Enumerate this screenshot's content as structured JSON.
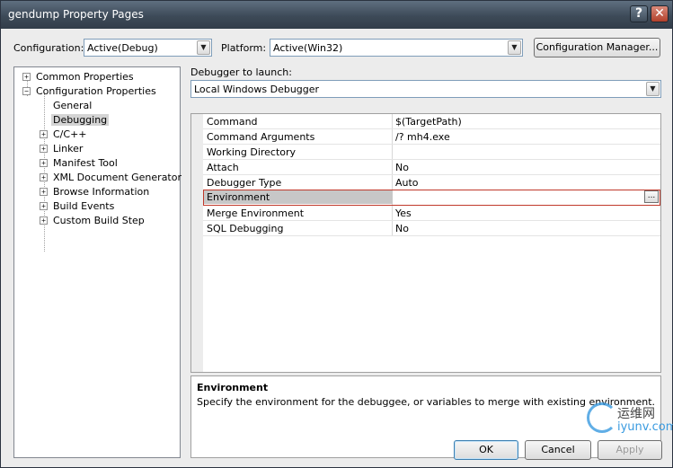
{
  "window": {
    "title": "gendump Property Pages",
    "help_label": "?",
    "close_label": "✕"
  },
  "toolbar": {
    "configuration_label": "Configuration:",
    "configuration_value": "Active(Debug)",
    "platform_label": "Platform:",
    "platform_value": "Active(Win32)",
    "config_manager_label": "Configuration Manager..."
  },
  "tree": {
    "items": [
      {
        "label": "Common Properties",
        "expander": "+"
      },
      {
        "label": "Configuration Properties",
        "expander": "−"
      },
      {
        "label": "General"
      },
      {
        "label": "Debugging"
      },
      {
        "label": "C/C++",
        "expander": "+"
      },
      {
        "label": "Linker",
        "expander": "+"
      },
      {
        "label": "Manifest Tool",
        "expander": "+"
      },
      {
        "label": "XML Document Generator",
        "expander": "+"
      },
      {
        "label": "Browse Information",
        "expander": "+"
      },
      {
        "label": "Build Events",
        "expander": "+"
      },
      {
        "label": "Custom Build Step",
        "expander": "+"
      }
    ]
  },
  "debugger": {
    "label": "Debugger to launch:",
    "value": "Local Windows Debugger"
  },
  "grid": {
    "rows": [
      {
        "name": "Command",
        "value": "$(TargetPath)"
      },
      {
        "name": "Command Arguments",
        "value": "/? mh4.exe"
      },
      {
        "name": "Working Directory",
        "value": ""
      },
      {
        "name": "Attach",
        "value": "No"
      },
      {
        "name": "Debugger Type",
        "value": "Auto"
      },
      {
        "name": "Environment",
        "value": ""
      },
      {
        "name": "Merge Environment",
        "value": "Yes"
      },
      {
        "name": "SQL Debugging",
        "value": "No"
      }
    ],
    "ellipsis": "..."
  },
  "description": {
    "title": "Environment",
    "text": "Specify the environment for the debuggee, or variables to merge with existing environment."
  },
  "buttons": {
    "ok": "OK",
    "cancel": "Cancel",
    "apply": "Apply"
  },
  "watermark": {
    "cn": "运维网",
    "en": "iyunv.com"
  }
}
